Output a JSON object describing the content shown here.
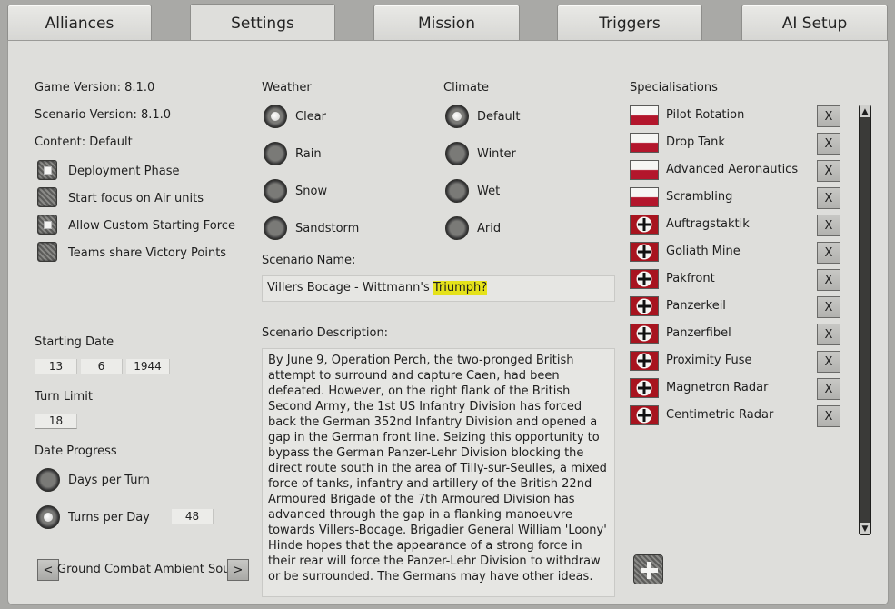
{
  "tabs": [
    {
      "label": "Alliances"
    },
    {
      "label": "Settings"
    },
    {
      "label": "Mission"
    },
    {
      "label": "Triggers"
    },
    {
      "label": "AI Setup"
    }
  ],
  "game_version": "Game Version: 8.1.0",
  "scenario_version": "Scenario Version: 8.1.0",
  "content": "Content: Default",
  "options": [
    {
      "label": "Deployment Phase",
      "checked": true
    },
    {
      "label": "Start focus on Air units",
      "checked": false
    },
    {
      "label": "Allow Custom Starting Force",
      "checked": true
    },
    {
      "label": "Teams share Victory Points",
      "checked": false
    }
  ],
  "starting_date": {
    "label": "Starting Date",
    "day": "13",
    "month": "6",
    "year": "1944"
  },
  "turn_limit": {
    "label": "Turn Limit",
    "value": "18"
  },
  "date_progress": {
    "label": "Date Progress",
    "days_per_turn": "Days per Turn",
    "turns_per_day": "Turns per Day",
    "turns_value": "48",
    "selected": "turns_per_day"
  },
  "ambient": {
    "prev": "<",
    "label": "Ground Combat Ambient Sound",
    "next": ">"
  },
  "weather": {
    "label": "Weather",
    "options": [
      "Clear",
      "Rain",
      "Snow",
      "Sandstorm"
    ],
    "selected": "Clear"
  },
  "climate": {
    "label": "Climate",
    "options": [
      "Default",
      "Winter",
      "Wet",
      "Arid"
    ],
    "selected": "Default"
  },
  "scenario_name": {
    "label": "Scenario Name:",
    "text_before": "Villers Bocage - Wittmann's ",
    "highlighted": "Triumph?"
  },
  "scenario_description": {
    "label": "Scenario Description:",
    "text": "By June 9, Operation Perch, the two-pronged British attempt to surround and capture Caen, had been defeated.  However, on the right flank of the British Second Army, the 1st US Infantry Division has forced back the German 352nd Infantry Division and opened a gap in the German front line. Seizing this opportunity to bypass the German Panzer-Lehr Division blocking the direct route south in the area of Tilly-sur-Seulles, a mixed force of tanks, infantry and artillery of the British 22nd Armoured Brigade of the 7th Armoured Division has advanced through the gap in a flanking manoeuvre towards Villers-Bocage. Brigadier General William 'Loony' Hinde hopes that the appearance of a strong force in their rear will force the Panzer-Lehr Division to withdraw or be surrounded. The Germans may have other ideas."
  },
  "specialisations": {
    "label": "Specialisations",
    "remove_label": "X",
    "items": [
      {
        "name": "Pilot Rotation",
        "flag": "poland-flag-icon"
      },
      {
        "name": "Drop Tank",
        "flag": "poland-flag-icon"
      },
      {
        "name": "Advanced Aeronautics",
        "flag": "poland-flag-icon"
      },
      {
        "name": "Scrambling",
        "flag": "poland-flag-icon"
      },
      {
        "name": "Auftragstaktik",
        "flag": "german-cross-flag-icon"
      },
      {
        "name": "Goliath Mine",
        "flag": "german-cross-flag-icon"
      },
      {
        "name": "Pakfront",
        "flag": "german-cross-flag-icon"
      },
      {
        "name": "Panzerkeil",
        "flag": "german-cross-flag-icon"
      },
      {
        "name": "Panzerfibel",
        "flag": "german-cross-flag-icon"
      },
      {
        "name": "Proximity Fuse",
        "flag": "german-cross-flag-icon"
      },
      {
        "name": "Magnetron Radar",
        "flag": "german-cross-flag-icon"
      },
      {
        "name": "Centimetric Radar",
        "flag": "german-cross-flag-icon"
      }
    ]
  },
  "scroll": {
    "up": "▲",
    "down": "▼"
  },
  "colors": {
    "highlight": "#e5e21a",
    "panel": "#dededb",
    "flag_red": "#a8141f"
  }
}
